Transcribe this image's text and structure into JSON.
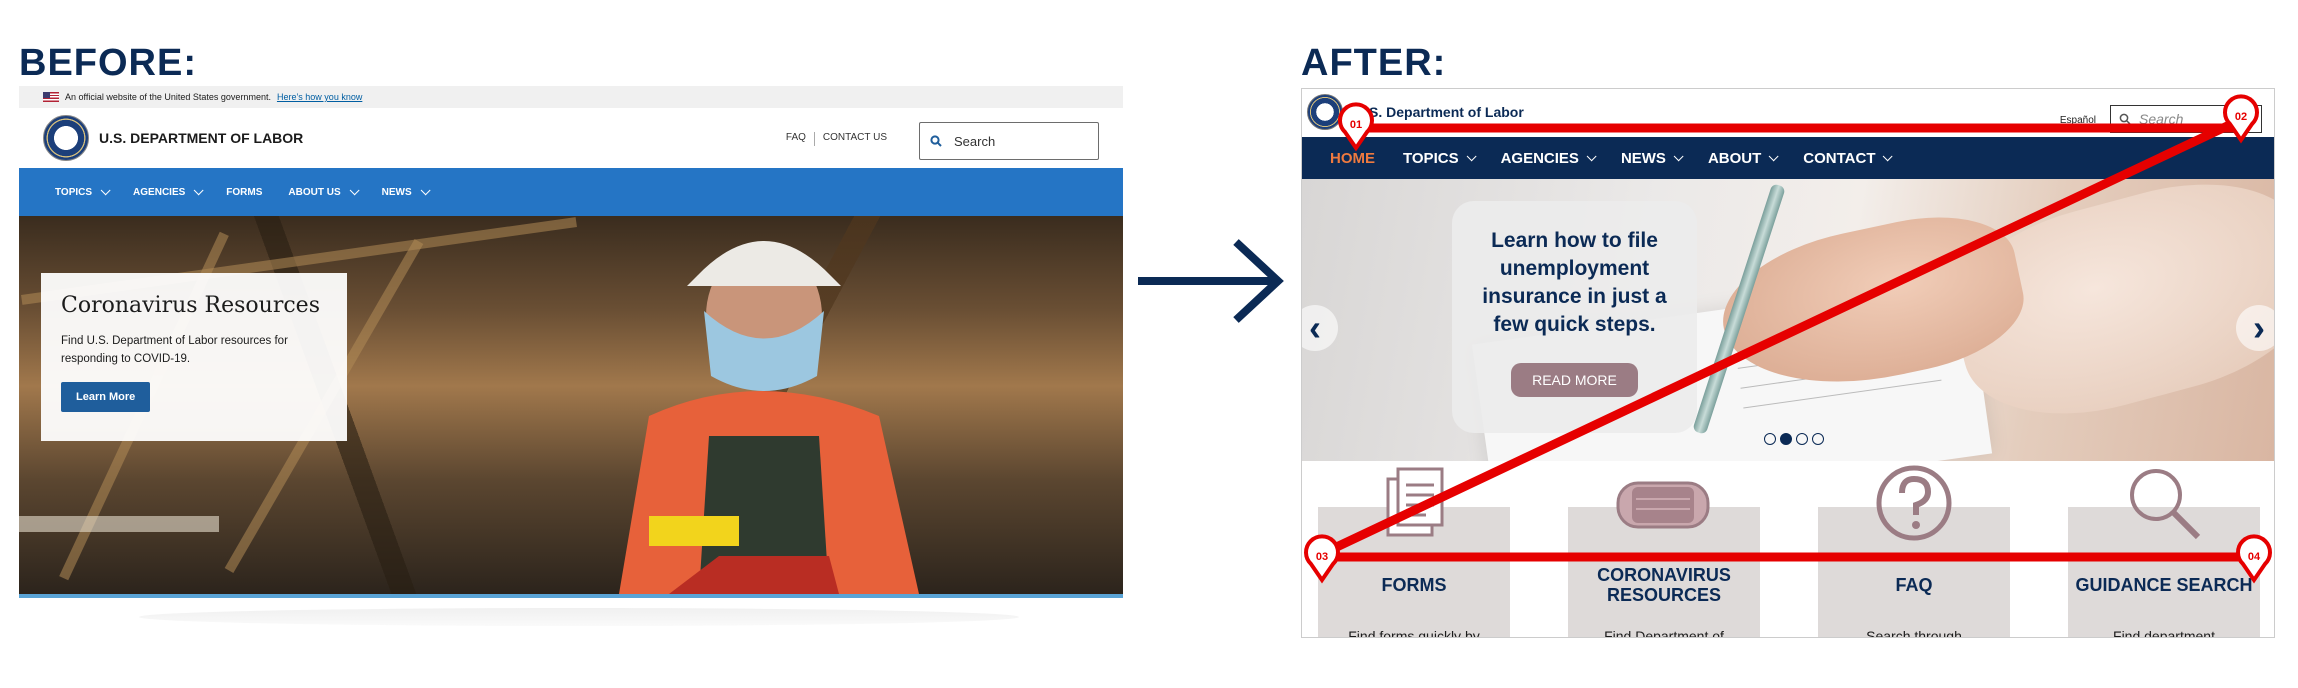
{
  "labels": {
    "before": "BEFORE:",
    "after": "AFTER:"
  },
  "before": {
    "gov_banner": {
      "text": "An official website of the United States government.",
      "link": "Here’s how you know"
    },
    "agency_name": "U.S. DEPARTMENT OF LABOR",
    "utility_links": [
      "FAQ",
      "CONTACT US"
    ],
    "search_placeholder": "Search",
    "nav": [
      "TOPICS",
      "AGENCIES",
      "FORMS",
      "ABOUT US",
      "NEWS"
    ],
    "hero": {
      "title": "Coronavirus Resources",
      "body": "Find U.S. Department of Labor resources for responding to COVID-19.",
      "button": "Learn More"
    }
  },
  "after": {
    "agency_name": "U.S. Department of Labor",
    "language_link": "Español",
    "search_placeholder": "Search",
    "nav": [
      {
        "label": "HOME",
        "active": true
      },
      {
        "label": "TOPICS",
        "active": false
      },
      {
        "label": "AGENCIES",
        "active": false
      },
      {
        "label": "NEWS",
        "active": false
      },
      {
        "label": "ABOUT",
        "active": false
      },
      {
        "label": "CONTACT",
        "active": false
      }
    ],
    "hero": {
      "headline": "Learn how to file unemployment insurance in just a few quick steps.",
      "button": "READ MORE"
    },
    "carousel": {
      "slides": 4,
      "active_index": 1
    },
    "cards": [
      {
        "title": "FORMS",
        "text": "Find forms quickly by",
        "icon": "document-icon"
      },
      {
        "title": "CORONAVIRUS RESOURCES",
        "text": "Find Department of",
        "icon": "face-mask-icon"
      },
      {
        "title": "FAQ",
        "text": "Search through",
        "icon": "question-icon"
      },
      {
        "title": "GUIDANCE SEARCH",
        "text": "Find department",
        "icon": "magnifier-icon"
      }
    ]
  },
  "annotations": {
    "markers": [
      "01",
      "02",
      "03",
      "04"
    ],
    "color": "#e60000"
  },
  "colors": {
    "heading": "#0b2a55",
    "before_nav": "#2575c5",
    "after_nav": "#0b2a55",
    "after_active": "#ef7a3f",
    "card_accent": "#9b7c84"
  }
}
